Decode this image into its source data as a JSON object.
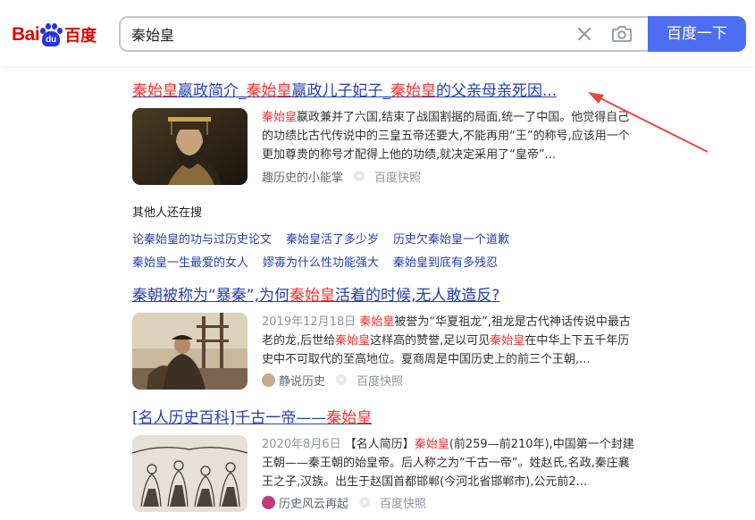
{
  "header": {
    "logo": {
      "latin_left": "Bai",
      "paw_text": "du",
      "chinese": "百度"
    },
    "search": {
      "value": "秦始皇",
      "placeholder": ""
    },
    "search_button_label": "百度一下"
  },
  "results": [
    {
      "title_parts": [
        "秦始皇",
        "嬴政简介_",
        "秦始皇",
        "嬴政儿子妃子_",
        "秦始皇",
        "的父亲母亲死因..."
      ],
      "abstract": {
        "date": "",
        "parts": [
          "秦始皇",
          "嬴政兼并了六国,结束了战国割据的局面,统一了中国。他觉得自己的功绩比古代传说中的三皇五帝还要大,不能再用“王”的称号,应该用一个更加尊贵的称号才配得上他的功绩,就决定采用了“皇帝”..."
        ]
      },
      "source": "趣历史的小能掌",
      "snapshot": "百度快照"
    },
    {
      "title_parts": [
        "秦朝被称为“暴秦”,为何",
        "秦始皇",
        "活着的时候,无人敢造反?"
      ],
      "abstract": {
        "date": "2019年12月18日",
        "parts": [
          "秦始皇",
          "被誉为“华夏祖龙”,祖龙是古代神话传说中最古老的龙,后世给",
          "秦始皇",
          "这样高的赞誉,足以可见",
          "秦始皇",
          "在中华上下五千年历史中不可取代的至高地位。夏商周是中国历史上的前三个王朝,..."
        ]
      },
      "source": "静说历史",
      "snapshot": "百度快照"
    },
    {
      "title_parts": [
        "[名人历史百科]千古一帝——",
        "秦始皇"
      ],
      "abstract": {
        "date": "2020年8月6日",
        "parts": [
          "【名人简历】",
          "秦始皇",
          "(前259—前210年),中国第一个封建王朝——秦王朝的始皇帝。后人称之为“千古一帝”。姓赵氏,名政,秦庄襄王之子,汉族。出生于赵国首都邯郸(今河北省邯郸市),公元前2..."
        ]
      },
      "source": "历史风云再起",
      "snapshot": "百度快照"
    }
  ],
  "related": {
    "title": "其他人还在搜",
    "row1": [
      "论秦始皇的功与过历史论文",
      "秦始皇活了多少岁",
      "历史欠秦始皇一个道歉"
    ],
    "row2": [
      "秦始皇一生最爱的女人",
      "嫪毐为什么性功能强大",
      "秦始皇到底有多残忍"
    ]
  },
  "colors": {
    "accent_blue": "#4e6ef2",
    "link_blue": "#2440b3",
    "highlight_red": "#f73131",
    "logo_red": "#e10602",
    "logo_blue": "#2932e1",
    "annotation_arrow": "#e8473f"
  },
  "icons": {
    "clear": "close-icon",
    "camera": "camera-icon",
    "source_separator": "dot-icon"
  }
}
